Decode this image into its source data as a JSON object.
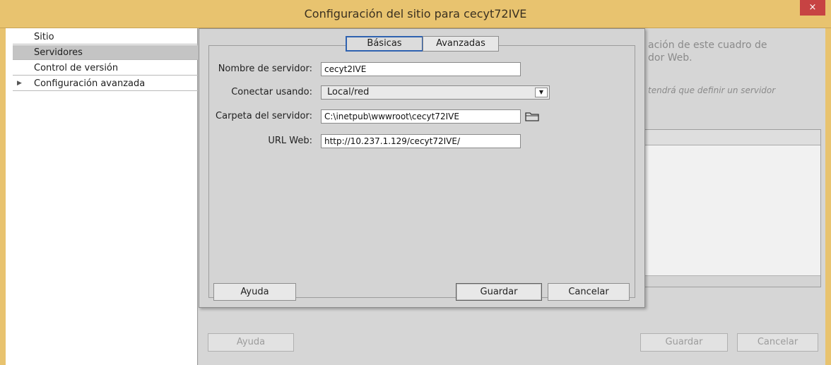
{
  "window": {
    "title": "Configuración del sitio para cecyt72IVE",
    "close_glyph": "×"
  },
  "sidebar": {
    "items": [
      {
        "label": "Sitio"
      },
      {
        "label": "Servidores"
      },
      {
        "label": "Control de versión"
      },
      {
        "label": "Configuración avanzada",
        "expand_glyph": "▶"
      }
    ],
    "selected": "Servidores"
  },
  "background": {
    "text_line1": "ación de este cuadro de",
    "text_line2": "dor Web.",
    "italic_text": "tendrá que definir un servidor",
    "help_label": "Ayuda",
    "save_label": "Guardar",
    "cancel_label": "Cancelar"
  },
  "dialog": {
    "tabs": [
      {
        "label": "Básicas"
      },
      {
        "label": "Avanzadas"
      }
    ],
    "active_tab": "Básicas",
    "fields": {
      "server_name": {
        "label": "Nombre de servidor:",
        "value": "cecyt2IVE"
      },
      "connect_using": {
        "label": "Conectar usando:",
        "value": "Local/red"
      },
      "server_folder": {
        "label": "Carpeta del servidor:",
        "value": "C:\\inetpub\\wwwroot\\cecyt72IVE"
      },
      "web_url": {
        "label": "URL Web:",
        "value": "http://10.237.1.129/cecyt72IVE/"
      }
    },
    "buttons": {
      "help": "Ayuda",
      "save": "Guardar",
      "cancel": "Cancelar"
    }
  },
  "colors": {
    "titlebar": "#e8c36f",
    "close": "#c74343",
    "active_tab_border": "#2f62b0"
  }
}
